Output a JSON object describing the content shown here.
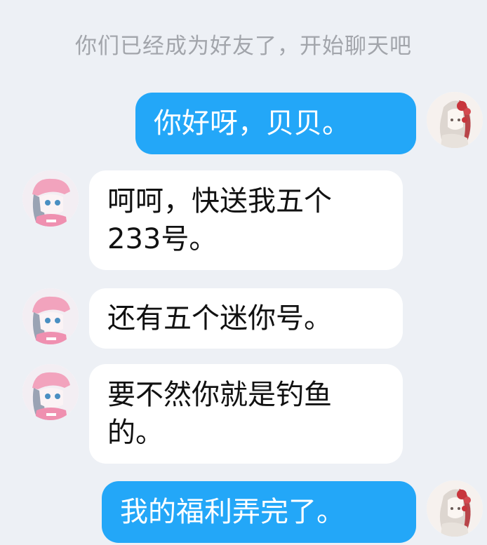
{
  "chat": {
    "system_notice": "你们已经成为好友了，开始聊天吧",
    "messages": [
      {
        "sender": "self",
        "text": "你好呀，贝贝。"
      },
      {
        "sender": "other",
        "text": "呵呵，快送我五个233号。"
      },
      {
        "sender": "other",
        "text": "还有五个迷你号。"
      },
      {
        "sender": "other",
        "text": "要不然你就是钓鱼的。"
      },
      {
        "sender": "self",
        "text": "我的福利弄完了。"
      }
    ]
  },
  "colors": {
    "background": "#edf0f5",
    "self_bubble": "#23a7f8",
    "other_bubble": "#ffffff",
    "notice_text": "#a2a5ab"
  },
  "icons": {
    "self_avatar": "red-flower-girl-avatar",
    "other_avatar": "pink-cap-girl-avatar"
  }
}
